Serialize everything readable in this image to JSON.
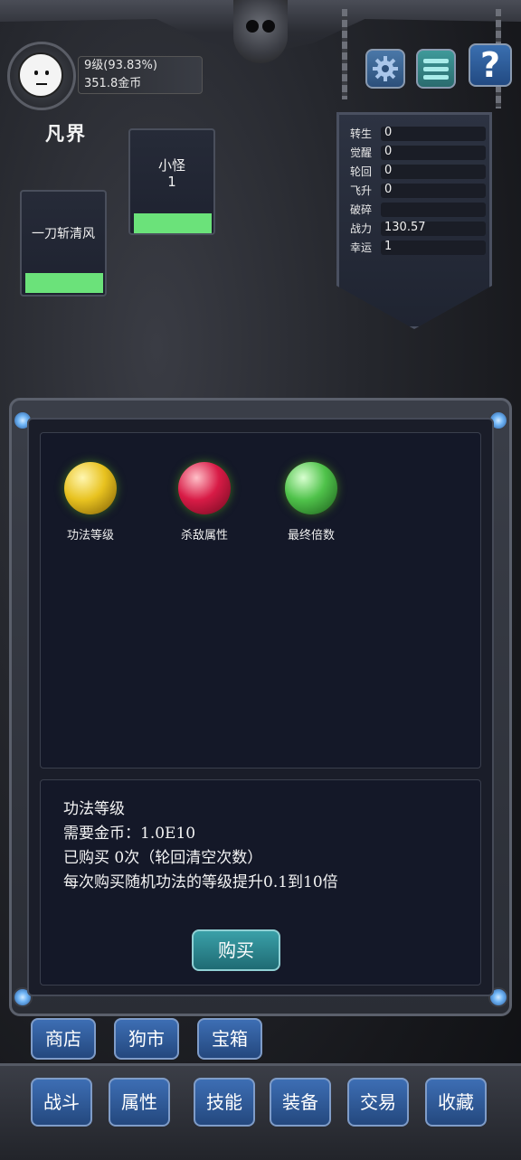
{
  "player": {
    "level_text": "9级(93.83%)",
    "gold_text": "351.8金币",
    "realm": "凡界"
  },
  "top_buttons": {
    "settings_icon": "gear-icon",
    "menu_icon": "menu-icon",
    "help_label": "?"
  },
  "stats": [
    {
      "label": "转生",
      "value": "0"
    },
    {
      "label": "觉醒",
      "value": "0"
    },
    {
      "label": "轮回",
      "value": "0"
    },
    {
      "label": "飞升",
      "value": "0"
    },
    {
      "label": "破碎",
      "value": ""
    },
    {
      "label": "战力",
      "value": "130.57"
    },
    {
      "label": "幸运",
      "value": "1"
    }
  ],
  "enemy": {
    "name": "小怪",
    "level": "1",
    "hp_fraction": 1.0
  },
  "character": {
    "name": "一刀斩清风",
    "hp_fraction": 1.0
  },
  "upgrades": [
    {
      "label": "功法等级",
      "color": "#e8c21f"
    },
    {
      "label": "杀敌属性",
      "color": "#d81b46"
    },
    {
      "label": "最终倍数",
      "color": "#4fc24a"
    }
  ],
  "description": {
    "title": "功法等级",
    "cost": "需要金币：1.0E10",
    "purchased": "已购买 0次（轮回清空次数）",
    "effect": "每次购买随机功法的等级提升0.1到10倍"
  },
  "buy_label": "购买",
  "shop_tabs": [
    "商店",
    "狗市",
    "宝箱"
  ],
  "main_nav": [
    "战斗",
    "属性",
    "技能",
    "装备",
    "交易",
    "收藏"
  ]
}
